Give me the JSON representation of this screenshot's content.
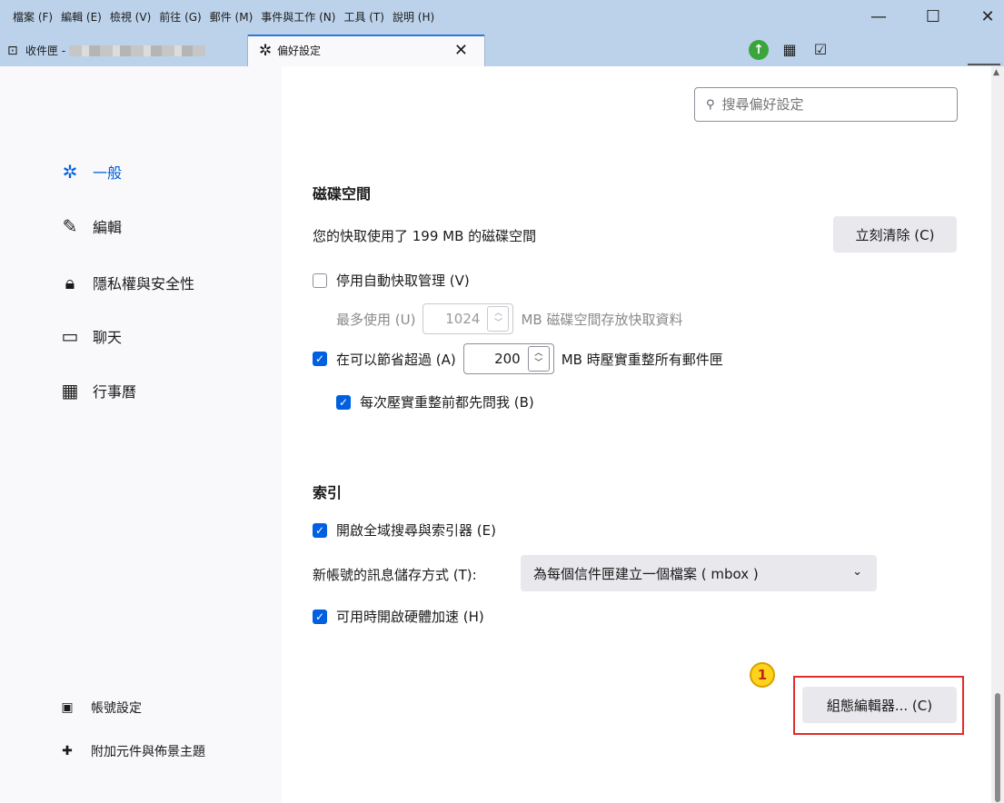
{
  "menubar": [
    "檔案 (F)",
    "編輯 (E)",
    "檢視 (V)",
    "前往 (G)",
    "郵件 (M)",
    "事件與工作 (N)",
    "工具 (T)",
    "說明 (H)"
  ],
  "window_controls": {
    "minimize": "—",
    "maximize": "☐",
    "close": "✕"
  },
  "tabs": {
    "inbox": {
      "label": "收件匣 -"
    },
    "prefs": {
      "label": "偏好設定",
      "close": "✕"
    }
  },
  "colors": {
    "accent": "#0060df",
    "highlight": "#e22b2b",
    "callout": "#ffd31a",
    "titlebar": "#bcd2ea"
  },
  "sidebar": {
    "items": [
      {
        "label": "一般",
        "icon": "gear-icon",
        "active": true
      },
      {
        "label": "編輯",
        "icon": "pencil-icon"
      },
      {
        "label": "隱私權與安全性",
        "icon": "lock-icon"
      },
      {
        "label": "聊天",
        "icon": "chat-icon"
      },
      {
        "label": "行事曆",
        "icon": "calendar-icon"
      }
    ],
    "bottom": [
      {
        "label": "帳號設定",
        "icon": "account-icon"
      },
      {
        "label": "附加元件與佈景主題",
        "icon": "puzzle-icon"
      }
    ]
  },
  "search": {
    "placeholder": "搜尋偏好設定"
  },
  "disk": {
    "heading": "磁碟空間",
    "usage_text": "您的快取使用了 199 MB 的磁碟空間",
    "clear_button": "立刻清除 (C)",
    "disable_auto_cache": "停用自動快取管理 (V)",
    "max_use_label": "最多使用 (U)",
    "max_use_value": "1024",
    "max_use_suffix": "MB 磁碟空間存放快取資料",
    "compact_label": "在可以節省超過 (A)",
    "compact_value": "200",
    "compact_suffix": "MB 時壓實重整所有郵件匣",
    "ask_before_compact": "每次壓實重整前都先問我 (B)"
  },
  "indexing": {
    "heading": "索引",
    "global_search": "開啟全域搜尋與索引器 (E)",
    "storage_label": "新帳號的訊息儲存方式 (T):",
    "storage_value": "為每個信件匣建立一個檔案 ( mbox )",
    "hw_accel": "可用時開啟硬體加速 (H)"
  },
  "config_editor_button": "組態編輯器... (C)",
  "callout_number": "1"
}
